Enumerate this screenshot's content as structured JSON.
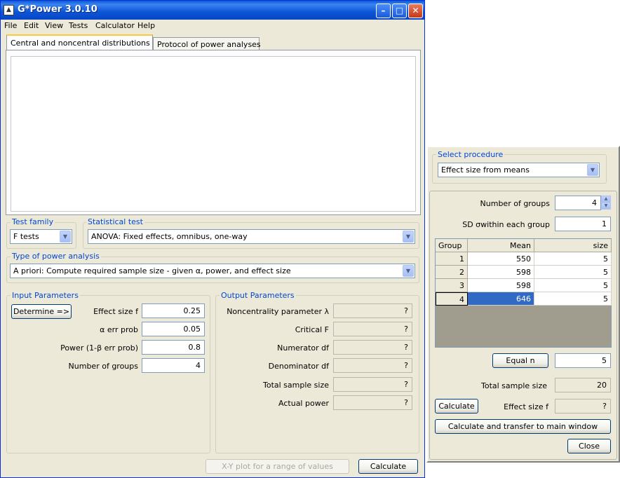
{
  "window": {
    "title": "G*Power 3.0.10"
  },
  "menu": [
    "File",
    "Edit",
    "View",
    "Tests",
    "Calculator",
    "Help"
  ],
  "tabs": [
    "Central and noncentral distributions",
    "Protocol of power analyses"
  ],
  "test_family": {
    "label": "Test family",
    "value": "F tests"
  },
  "statistical_test": {
    "label": "Statistical test",
    "value": "ANOVA: Fixed effects, omnibus, one-way"
  },
  "power_analysis": {
    "label": "Type of power analysis",
    "value": "A priori: Compute required sample size - given α, power, and effect size"
  },
  "input": {
    "label": "Input Parameters",
    "determine_button": "Determine =>",
    "rows": [
      {
        "label": "Effect size f",
        "value": "0.25"
      },
      {
        "label": "α err prob",
        "value": "0.05"
      },
      {
        "label": "Power (1-β err prob)",
        "value": "0.8"
      },
      {
        "label": "Number of groups",
        "value": "4"
      }
    ]
  },
  "output": {
    "label": "Output Parameters",
    "rows": [
      {
        "label": "Noncentrality parameter λ",
        "value": "?"
      },
      {
        "label": "Critical F",
        "value": "?"
      },
      {
        "label": "Numerator df",
        "value": "?"
      },
      {
        "label": "Denominator df",
        "value": "?"
      },
      {
        "label": "Total sample size",
        "value": "?"
      },
      {
        "label": "Actual power",
        "value": "?"
      }
    ]
  },
  "bottom": {
    "xy_plot": "X-Y plot for a range of values",
    "calculate": "Calculate"
  },
  "dialog": {
    "procedure_label": "Select procedure",
    "procedure_value": "Effect size from means",
    "num_groups_label": "Number of groups",
    "num_groups_value": "4",
    "sd_label": "SD σwithin each group",
    "sd_value": "1",
    "table": {
      "headers": [
        "Group",
        "Mean",
        "size"
      ],
      "rows": [
        {
          "group": "1",
          "mean": "550",
          "size": "5"
        },
        {
          "group": "2",
          "mean": "598",
          "size": "5"
        },
        {
          "group": "3",
          "mean": "598",
          "size": "5"
        },
        {
          "group": "4",
          "mean": "646",
          "size": "5"
        }
      ]
    },
    "equal_n_button": "Equal n",
    "equal_n_value": "5",
    "total_sample_label": "Total sample size",
    "total_sample_value": "20",
    "calculate_button": "Calculate",
    "effect_size_label": "Effect size f",
    "effect_size_value": "?",
    "transfer_button": "Calculate and transfer to main window",
    "close_button": "Close"
  }
}
